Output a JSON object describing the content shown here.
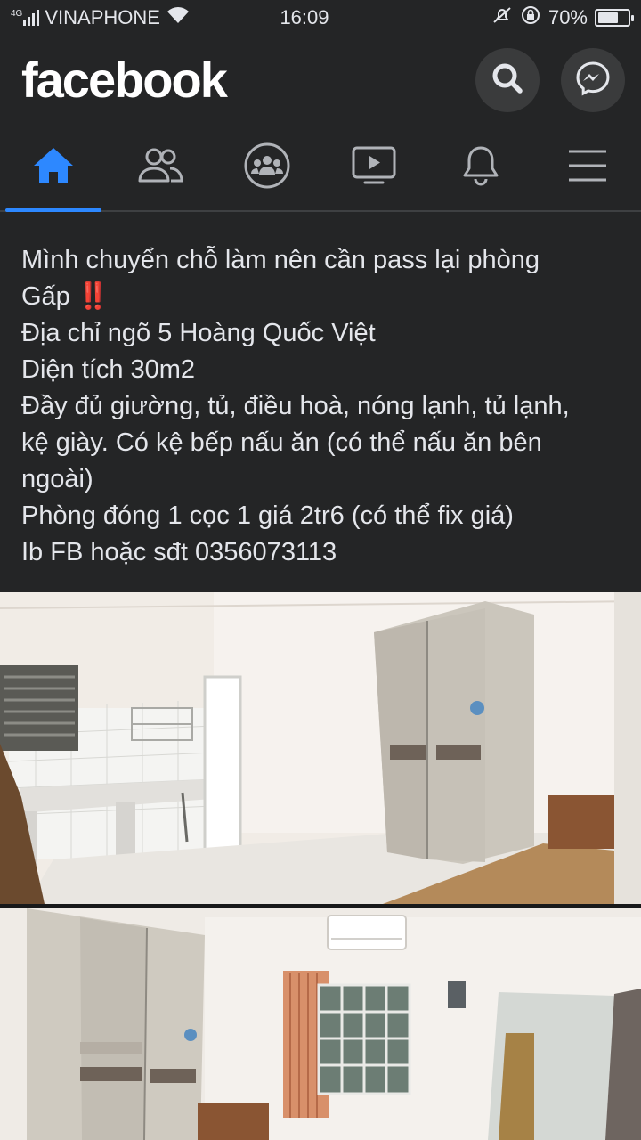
{
  "status_bar": {
    "network_type": "4G",
    "carrier": "VINAPHONE",
    "time": "16:09",
    "battery_percent": "70%",
    "battery_level": 0.7,
    "icons": [
      "signal-icon",
      "wifi-icon",
      "silent-icon",
      "rotation-lock-icon",
      "battery-icon"
    ]
  },
  "header": {
    "logo": "facebook",
    "buttons": [
      "search-icon",
      "messenger-icon"
    ]
  },
  "nav": {
    "tabs": [
      "home-icon",
      "friends-icon",
      "groups-icon",
      "watch-icon",
      "notifications-icon",
      "menu-icon"
    ],
    "active_index": 0,
    "active_color": "#2d88ff"
  },
  "post": {
    "lines": [
      "Mình chuyển chỗ làm nên cần pass lại phòng",
      "Gấp",
      "Địa chỉ ngõ 5 Hoàng Quốc Việt",
      "Diện tích 30m2",
      "Đầy đủ giường, tủ, điều hoà, nóng lạnh, tủ lạnh,",
      "kệ giày. Có kệ bếp nấu ăn (có thể nấu ăn bên",
      "ngoài)",
      "Phòng đóng 1 cọc 1 giá 2tr6 (có thể fix giá)",
      "Ib FB hoặc sđt 0356073113"
    ],
    "urgent_emoji": "‼️"
  },
  "photos": [
    "room-photo-kitchen-wardrobe",
    "room-photo-wardrobe-window"
  ]
}
